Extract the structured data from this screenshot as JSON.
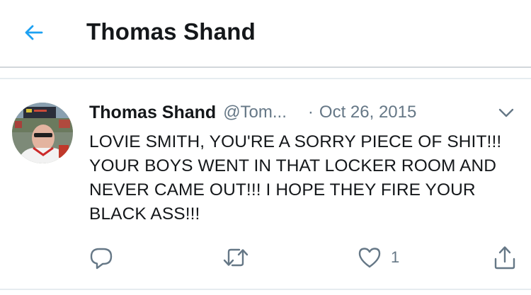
{
  "header": {
    "title": "Thomas Shand",
    "back_icon": "arrow-left-icon",
    "accent_color": "#1da1f2"
  },
  "tweet": {
    "display_name": "Thomas Shand",
    "handle": "@Tom...",
    "separator": "·",
    "date": "Oct 26, 2015",
    "menu_icon": "chevron-down-icon",
    "text": "LOVIE SMITH, YOU'RE A SORRY PIECE OF SHIT!!!  YOUR BOYS WENT IN THAT LOCKER ROOM AND NEVER CAME OUT!!!  I HOPE THEY FIRE YOUR BLACK ASS!!!",
    "actions": {
      "reply_icon": "reply-icon",
      "retweet_icon": "retweet-icon",
      "like_icon": "heart-icon",
      "like_count": "1",
      "share_icon": "share-icon"
    }
  },
  "colors": {
    "text_primary": "#14171a",
    "text_secondary": "#657786",
    "divider": "#e6ecf0"
  }
}
